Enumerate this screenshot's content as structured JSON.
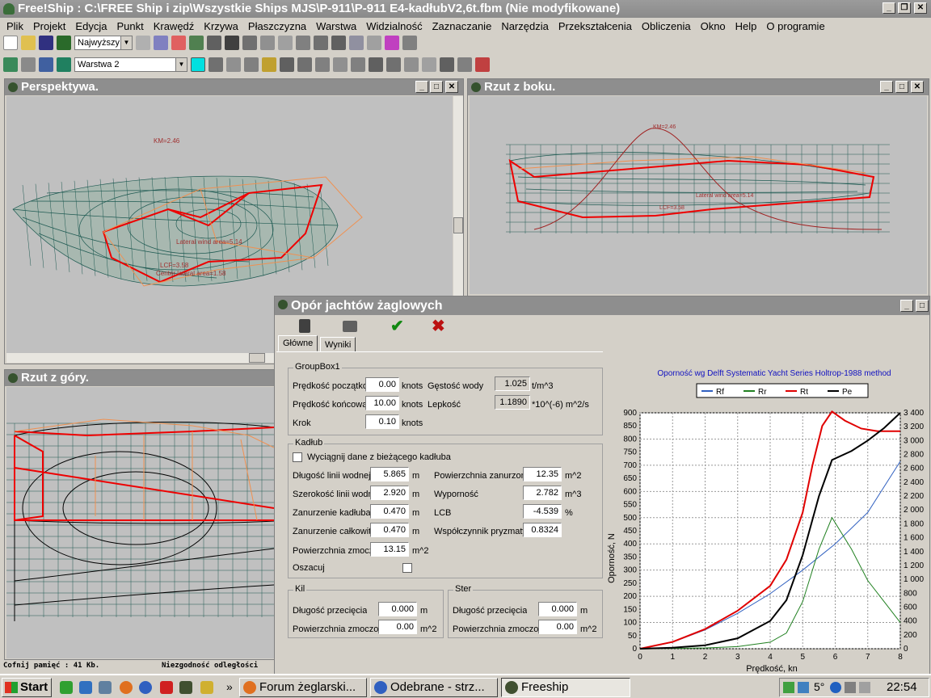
{
  "window": {
    "title": "Free!Ship  : C:\\FREE Ship i zip\\Wszystkie Ships MJS\\P-911\\P-911 E4-kadłubV2,6t.fbm (Nie modyfikowane)"
  },
  "menu": [
    "Plik",
    "Projekt",
    "Edycja",
    "Punkt",
    "Krawędź",
    "Krzywa",
    "Płaszczyzna",
    "Warstwa",
    "Widzialność",
    "Zaznaczanie",
    "Narzędzia",
    "Przekształcenia",
    "Obliczenia",
    "Okno",
    "Help",
    "O programie"
  ],
  "toolbar": {
    "precision_select": "Najwyższy",
    "layer_select": "Warstwa 2"
  },
  "views": {
    "perspective": {
      "title": "Perspektywa.",
      "km_label": "KM=2.46",
      "lateral_label": "Lateral wind area=5.14",
      "lcf_label": "LCF=3.58",
      "lcb_label": "Center lateral area=1.58"
    },
    "side": {
      "title": "Rzut z boku.",
      "km_label": "KM=2.46",
      "lateral_label": "Lateral wind area=5.14",
      "lcf_label": "LCF=3.58"
    },
    "top": {
      "title": "Rzut z góry."
    }
  },
  "dialog": {
    "title": "Opór jachtów żaglowych",
    "tabs": [
      "Główne",
      "Wyniki"
    ],
    "groupbox1": {
      "title": "GroupBox1",
      "start_speed_label": "Prędkość początkowa",
      "start_speed": "0.00",
      "start_speed_unit": "knots",
      "water_density_label": "Gęstość wody",
      "water_density": "1.025",
      "water_density_unit": "t/m^3",
      "end_speed_label": "Prędkość końcowa",
      "end_speed": "10.00",
      "end_speed_unit": "knots",
      "viscosity_label": "Lepkość",
      "viscosity": "1.1890",
      "viscosity_unit": "*10^(-6) m^2/s",
      "step_label": "Krok",
      "step": "0.10",
      "step_unit": "knots"
    },
    "hull": {
      "title": "Kadłub",
      "extract_label": "Wyciągnij dane z bieżącego kadłuba",
      "wl_length_label": "Długość linii wodnej",
      "wl_length": "5.865",
      "wl_length_unit": "m",
      "wetted_surface_label": "Powierzchnia zanurzona",
      "wetted_surface": "12.35",
      "wetted_surface_unit": "m^2",
      "wl_beam_label": "Szerokość linii wodnej",
      "wl_beam": "2.920",
      "wl_beam_unit": "m",
      "displacement_label": "Wyporność",
      "displacement": "2.782",
      "displacement_unit": "m^3",
      "hull_draft_label": "Zanurzenie kadłuba",
      "hull_draft": "0.470",
      "hull_draft_unit": "m",
      "lcb_label": "LCB",
      "lcb": "-4.539",
      "lcb_unit": "%",
      "total_draft_label": "Zanurzenie całkowite",
      "total_draft": "0.470",
      "total_draft_unit": "m",
      "prismatic_label": "Współczynnik pryzmatyczny",
      "prismatic": "0.8324",
      "wetted_area_label": "Powierzchnia zmoczona",
      "wetted_area": "13.15",
      "wetted_area_unit": "m^2",
      "estimate_label": "Oszacuj"
    },
    "keel": {
      "title": "Kil",
      "length_label": "Długość przecięcia",
      "length": "0.000",
      "length_unit": "m",
      "area_label": "Powierzchnia zmoczona",
      "area": "0.00",
      "area_unit": "m^2"
    },
    "rudder": {
      "title": "Ster",
      "length_label": "Długość przecięcia",
      "length": "0.000",
      "length_unit": "m",
      "area_label": "Powierzchnia zmoczona",
      "area": "0.00",
      "area_unit": "m^2"
    }
  },
  "chart_data": {
    "type": "line",
    "title": "Oporność wg Delft Systematic Yacht Series Holtrop-1988 method",
    "xlabel": "Prędkość, kn",
    "ylabel": "Oporność, N",
    "xlim": [
      0,
      8
    ],
    "ylim": [
      0,
      900
    ],
    "y2lim": [
      0,
      3400
    ],
    "x_ticks": [
      0,
      1,
      2,
      3,
      4,
      5,
      6,
      7,
      8
    ],
    "y_ticks": [
      0,
      50,
      100,
      150,
      200,
      250,
      300,
      350,
      400,
      450,
      500,
      550,
      600,
      650,
      700,
      750,
      800,
      850,
      900
    ],
    "y2_ticks": [
      "0",
      "200",
      "400",
      "600",
      "800",
      "1 000",
      "1 200",
      "1 400",
      "1 600",
      "1 800",
      "2 000",
      "2 200",
      "2 400",
      "2 600",
      "2 800",
      "3 000",
      "3 200",
      "3 400"
    ],
    "legend_position": "top",
    "grid": true,
    "series": [
      {
        "name": "Rf",
        "color": "#3060c0",
        "axis": "left",
        "x": [
          0,
          1,
          2,
          3,
          4,
          5,
          6,
          7,
          8
        ],
        "y": [
          0,
          25,
          72,
          135,
          210,
          300,
          400,
          520,
          715
        ]
      },
      {
        "name": "Rr",
        "color": "#208020",
        "axis": "left",
        "x": [
          0,
          1,
          2,
          3,
          4,
          4.5,
          5,
          5.5,
          5.9,
          6.5,
          7,
          7.5,
          8
        ],
        "y": [
          0,
          1,
          3,
          8,
          25,
          60,
          180,
          380,
          500,
          380,
          260,
          180,
          100
        ]
      },
      {
        "name": "Rt",
        "color": "#e00000",
        "axis": "left",
        "x": [
          0,
          1,
          2,
          3,
          4,
          4.5,
          5,
          5.3,
          5.6,
          5.9,
          6.3,
          6.8,
          7.3,
          8
        ],
        "y": [
          0,
          26,
          75,
          145,
          240,
          340,
          520,
          700,
          850,
          905,
          870,
          840,
          830,
          830
        ]
      },
      {
        "name": "Pe",
        "color": "#000000",
        "axis": "right",
        "x": [
          0,
          1,
          2,
          3,
          4,
          4.5,
          5,
          5.5,
          5.9,
          6.5,
          7,
          7.5,
          8
        ],
        "y": [
          0,
          15,
          50,
          150,
          400,
          700,
          1350,
          2200,
          2720,
          2850,
          3000,
          3180,
          3400
        ]
      }
    ]
  },
  "statusbar": {
    "undo": "Cofnij pamięć : 41 Kb.",
    "misc": "Niezgodność odległości"
  },
  "taskbar": {
    "start": "Start",
    "tasks": [
      "Forum żeglarski...",
      "Odebrane - strz...",
      "Freeship"
    ],
    "temp": "5°",
    "clock": "22:54"
  }
}
